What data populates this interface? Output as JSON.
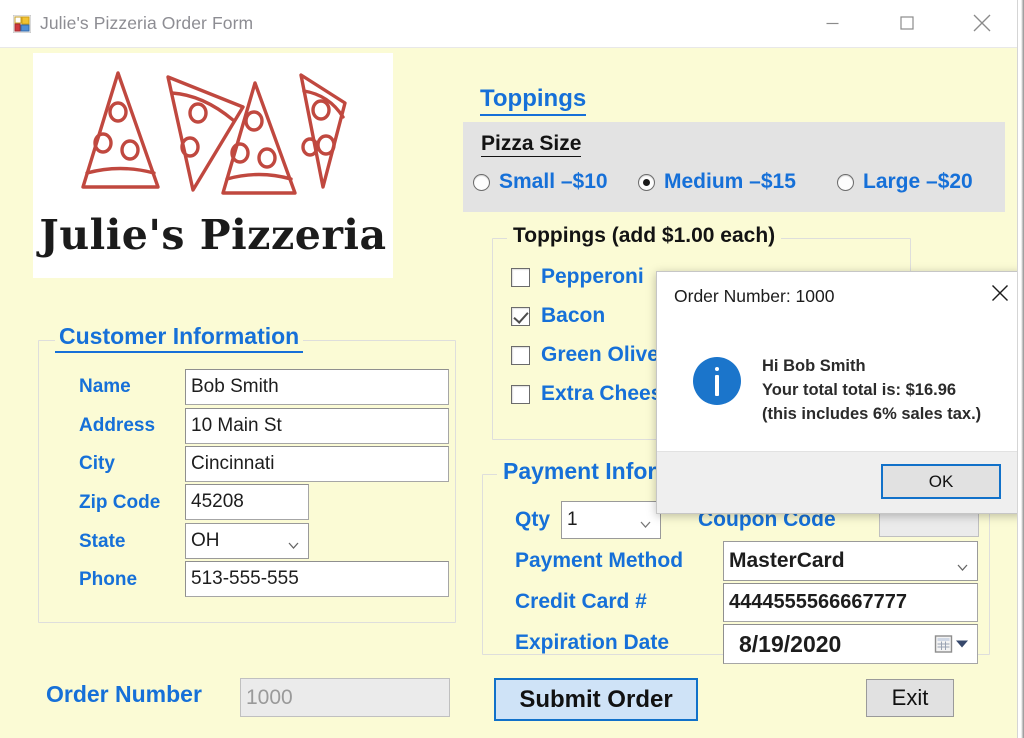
{
  "window": {
    "title": "Julie's Pizzeria Order Form",
    "icon": "winforms-icon",
    "minimize_label": "—",
    "maximize_label": "□",
    "close_label": "✕",
    "background_color": "#fbfbd5"
  },
  "logo": {
    "wordmark": "Julie's Pizzeria",
    "slice_count": 4,
    "slice_color": "#c0483f"
  },
  "customer": {
    "legend": "Customer Information",
    "fields": [
      {
        "label": "Name",
        "value": "Bob Smith",
        "type": "text"
      },
      {
        "label": "Address",
        "value": "10 Main St",
        "type": "text"
      },
      {
        "label": "City",
        "value": "Cincinnati",
        "type": "text"
      },
      {
        "label": "Zip Code",
        "value": "45208",
        "type": "text"
      },
      {
        "label": "State",
        "value": "OH",
        "type": "combo"
      },
      {
        "label": "Phone",
        "value": "513-555-555",
        "type": "text"
      }
    ]
  },
  "toppings_section": {
    "heading": "Toppings",
    "size_group": {
      "legend": "Pizza Size",
      "options": [
        {
          "label": "Small –$10",
          "selected": false
        },
        {
          "label": "Medium –$15",
          "selected": true
        },
        {
          "label": "Large –$20",
          "selected": false
        }
      ]
    },
    "toppings_group": {
      "legend": "Toppings (add $1.00 each)",
      "items": [
        {
          "label": "Pepperoni",
          "checked": false
        },
        {
          "label": "Bacon",
          "checked": true
        },
        {
          "label": "Green Olives",
          "checked": false
        },
        {
          "label": "Extra Cheese",
          "checked": false
        }
      ]
    }
  },
  "payment": {
    "legend": "Payment Information",
    "qty_label": "Qty",
    "qty_value": "1",
    "coupon_label": "Coupon Code",
    "coupon_value": "",
    "method_label": "Payment Method",
    "method_value": "MasterCard",
    "card_label": "Credit Card #",
    "card_value": "4444555566667777",
    "exp_label": "Expiration Date",
    "exp_value": "8/19/2020"
  },
  "footer": {
    "order_number_label": "Order Number",
    "order_number_value": "1000",
    "submit_label": "Submit Order",
    "exit_label": "Exit"
  },
  "dialog": {
    "title": "Order Number: 1000",
    "icon": "info-icon",
    "line1": "Hi Bob Smith",
    "line2": "Your total total is: $16.96",
    "line3": "(this includes 6% sales tax.)",
    "ok_label": "OK",
    "close_label": "✕",
    "accent_color": "#1b75cb"
  }
}
